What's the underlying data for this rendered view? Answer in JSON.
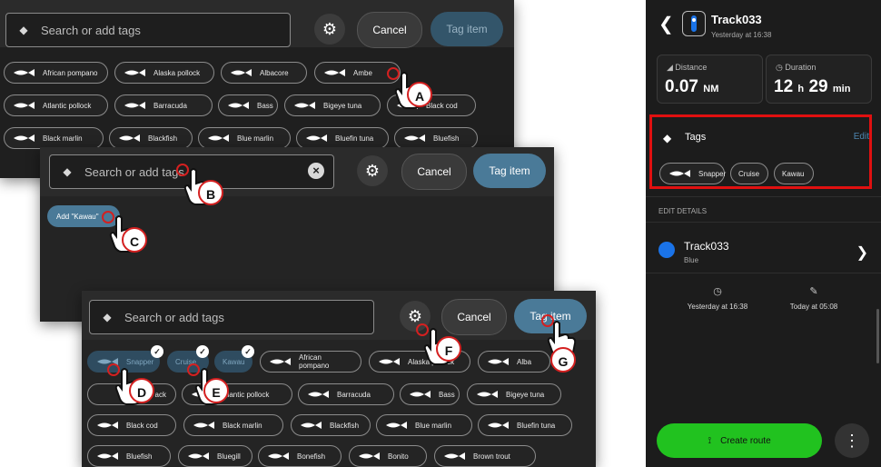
{
  "panel1": {
    "search_placeholder": "Search or add tags",
    "cancel": "Cancel",
    "tag_item": "Tag item",
    "chips": [
      "African pompano",
      "Alaska pollock",
      "Albacore",
      "Ambe",
      "Atlantic pollock",
      "Barracuda",
      "Bass",
      "Bigeye tuna",
      "Black cod",
      "Black marlin",
      "Blackfish",
      "Blue marlin",
      "Bluefin tuna",
      "Bluefish"
    ]
  },
  "panel2": {
    "search_placeholder": "Search or add tags",
    "cancel": "Cancel",
    "tag_item": "Tag item",
    "add_chip": "Add \"Kawau\""
  },
  "panel3": {
    "search_placeholder": "Search or add tags",
    "cancel": "Cancel",
    "tag_item": "Tag item",
    "selected_chips": [
      "Snapper",
      "Cruise",
      "Kawau"
    ],
    "chips_row1": [
      "African pompano",
      "Alaska pollock",
      "Alba"
    ],
    "chips_row2": [
      "ack",
      "Atlantic pollock",
      "Barracuda",
      "Bass",
      "Bigeye tuna"
    ],
    "chips_row3": [
      "Black cod",
      "Black marlin",
      "Blackfish",
      "Blue marlin",
      "Bluefin tuna"
    ],
    "chips_row4": [
      "Bluefish",
      "Bluegill",
      "Bonefish",
      "Bonito",
      "Brown trout"
    ]
  },
  "markers": [
    "A",
    "B",
    "C",
    "D",
    "E",
    "F",
    "G"
  ],
  "phone": {
    "title": "Track033",
    "subtitle": "Yesterday at 16:38",
    "distance_label": "Distance",
    "distance_value": "0.07",
    "distance_unit": "NM",
    "duration_label": "Duration",
    "duration_h": "12",
    "duration_h_unit": "h",
    "duration_m": "29",
    "duration_m_unit": "min",
    "tags_label": "Tags",
    "edit": "Edit",
    "tags": [
      "Snapper",
      "Cruise",
      "Kawau"
    ],
    "section": "EDIT DETAILS",
    "track_name": "Track033",
    "track_color": "Blue",
    "created": "Yesterday at 16:38",
    "edited": "Today at 05:08",
    "create_route": "Create route",
    "accent": "#21c21f",
    "highlight": "#e01010"
  }
}
